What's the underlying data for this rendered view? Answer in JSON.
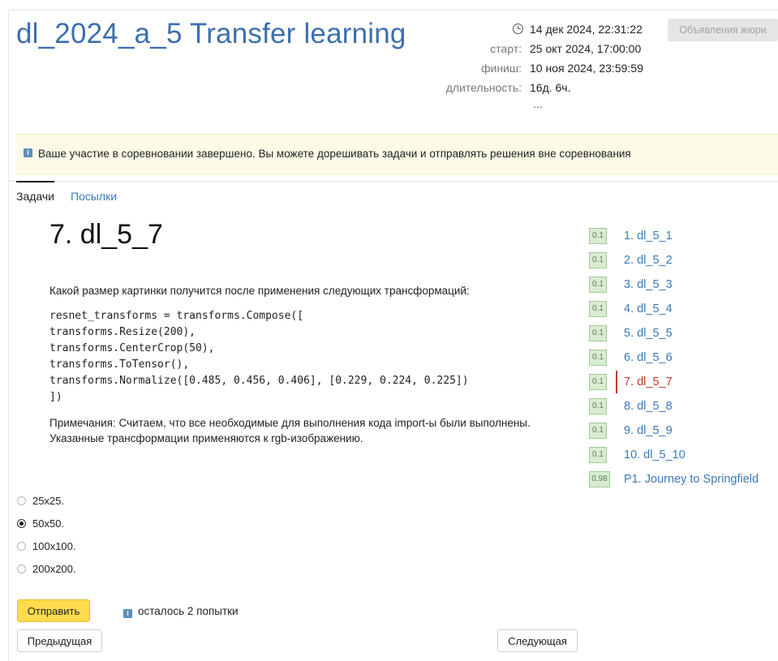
{
  "header": {
    "title": "dl_2024_a_5 Transfer learning",
    "jury_button": "Объявления жюри",
    "meta": {
      "current_time": "14 дек 2024, 22:31:22",
      "start_label": "старт:",
      "start": "25 окт 2024, 17:00:00",
      "finish_label": "финиш:",
      "finish": "10 ноя 2024, 23:59:59",
      "duration_label": "длительность:",
      "duration": "16д. 6ч.",
      "more": "..."
    }
  },
  "banner": {
    "icon": "info-icon",
    "text": "Ваше участие в соревновании завершено. Вы можете дорешивать задачи и отправлять решения вне соревнования"
  },
  "tabs": [
    {
      "label": "Задачи",
      "active": true
    },
    {
      "label": "Посылки",
      "active": false
    }
  ],
  "problem": {
    "title": "7. dl_5_7",
    "question": "Какой размер картинки получится после применения следующих трансформаций:",
    "code": "resnet_transforms = transforms.Compose([\ntransforms.Resize(200),\ntransforms.CenterCrop(50),\ntransforms.ToTensor(),\ntransforms.Normalize([0.485, 0.456, 0.406], [0.229, 0.224, 0.225])\n])",
    "note_line1": "Примечания: Считаем, что все необходимые для выполнения кода import-ы были выполнены.",
    "note_line2": "Указанные трансформации применяются к rgb-изображению.",
    "options": [
      {
        "label": "25x25.",
        "checked": false
      },
      {
        "label": "50x50.",
        "checked": true
      },
      {
        "label": "100x100.",
        "checked": false
      },
      {
        "label": "200x200.",
        "checked": false
      }
    ],
    "submit_label": "Отправить",
    "attempts_text": "осталось 2 попытки",
    "prev_label": "Предыдущая",
    "next_label": "Следующая"
  },
  "problem_list": [
    {
      "score": "0.1",
      "label": "1. dl_5_1",
      "current": false
    },
    {
      "score": "0.1",
      "label": "2. dl_5_2",
      "current": false
    },
    {
      "score": "0.1",
      "label": "3. dl_5_3",
      "current": false
    },
    {
      "score": "0.1",
      "label": "4. dl_5_4",
      "current": false
    },
    {
      "score": "0.1",
      "label": "5. dl_5_5",
      "current": false
    },
    {
      "score": "0.1",
      "label": "6. dl_5_6",
      "current": false
    },
    {
      "score": "0.1",
      "label": "7. dl_5_7",
      "current": true
    },
    {
      "score": "0.1",
      "label": "8. dl_5_8",
      "current": false
    },
    {
      "score": "0.1",
      "label": "9. dl_5_9",
      "current": false
    },
    {
      "score": "0.1",
      "label": "10. dl_5_10",
      "current": false
    },
    {
      "score": "0.98",
      "label": "P1. Journey to Springfield",
      "current": false
    }
  ],
  "colors": {
    "link": "#3d78b8",
    "title": "#3d6fae",
    "current": "#c0392b",
    "submit": "#ffdb4d",
    "banner": "#fdfbe8",
    "score_badge": "#d9ecd2"
  }
}
